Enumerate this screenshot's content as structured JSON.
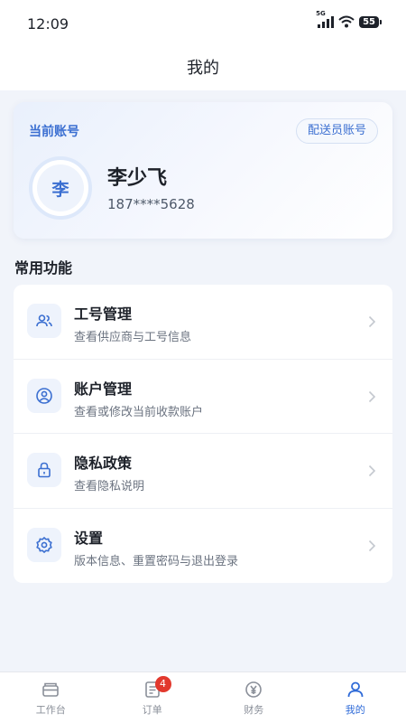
{
  "status_bar": {
    "time": "12:09",
    "network": "5G",
    "battery": "55"
  },
  "header": {
    "title": "我的"
  },
  "account": {
    "label": "当前账号",
    "role": "配送员账号",
    "avatar_text": "李",
    "name": "李少飞",
    "phone": "187****5628"
  },
  "section_title": "常用功能",
  "menu": [
    {
      "title": "工号管理",
      "subtitle": "查看供应商与工号信息",
      "icon": "users-icon"
    },
    {
      "title": "账户管理",
      "subtitle": "查看或修改当前收款账户",
      "icon": "user-circle-icon"
    },
    {
      "title": "隐私政策",
      "subtitle": "查看隐私说明",
      "icon": "lock-icon"
    },
    {
      "title": "设置",
      "subtitle": "版本信息、重置密码与退出登录",
      "icon": "gear-icon"
    }
  ],
  "tabs": [
    {
      "label": "工作台",
      "icon": "workbench-icon"
    },
    {
      "label": "订单",
      "icon": "orders-icon",
      "badge": "4"
    },
    {
      "label": "财务",
      "icon": "finance-icon"
    },
    {
      "label": "我的",
      "icon": "profile-icon",
      "active": true
    }
  ],
  "colors": {
    "accent": "#2f6bd8",
    "badge": "#e2382d",
    "background": "#f1f4fa"
  }
}
